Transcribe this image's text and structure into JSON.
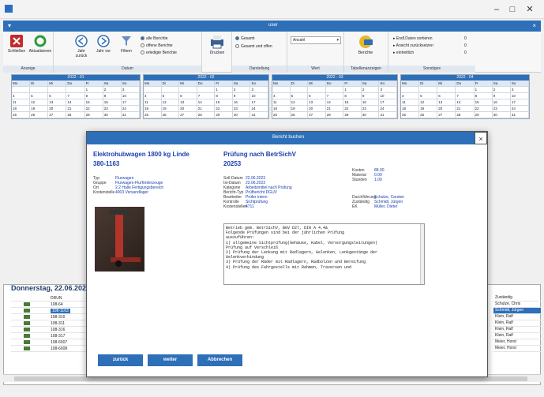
{
  "window": {
    "title": "",
    "controls": [
      "–",
      "□",
      "✕"
    ]
  },
  "ribbon_bar": {
    "title": "user",
    "menu": "▾",
    "close": "×"
  },
  "ribbon": {
    "anzeige": {
      "label": "Anzeige",
      "buttons": [
        "Schließen",
        "Aktualisieren"
      ]
    },
    "datum": {
      "label": "Datum",
      "buttons": [
        "Jahr zurück",
        "Jahr vor",
        "Filtern"
      ],
      "radios": [
        "alle Berichte",
        "offene Berichte",
        "erledigte Berichte"
      ],
      "selected": 0
    },
    "drucken": {
      "label": "Drucken"
    },
    "darstellung": {
      "label": "Darstellung",
      "radios": [
        "Gesamt",
        "Gesamt und offen"
      ],
      "selected": 0
    },
    "wert": {
      "label": "Wert",
      "value": "Anzahl"
    },
    "tabellen": {
      "label": "Tabellenanzeigen",
      "button": "Berichte"
    },
    "sonstiges": {
      "label": "Sonstiges",
      "items": [
        "Endl.Daten sortieren",
        "Ansicht zurücksetzen",
        "einheitlich"
      ],
      "values": [
        "0",
        "0",
        "0"
      ]
    }
  },
  "calendars": [
    {
      "title": "2022 - 01"
    },
    {
      "title": "2022 - 02"
    },
    {
      "title": "2022 - 03"
    },
    {
      "title": "2022 - 04"
    }
  ],
  "weekdays": [
    "Mo",
    "Di",
    "Mi",
    "Do",
    "Fr",
    "Sa",
    "So"
  ],
  "cal_rows": [
    [
      "",
      "",
      "",
      "",
      "1",
      "2",
      "3"
    ],
    [
      "4",
      "5",
      "6",
      "7",
      "8",
      "9",
      "10"
    ],
    [
      "11",
      "12",
      "13",
      "14",
      "15",
      "16",
      "17"
    ],
    [
      "18",
      "19",
      "20",
      "21",
      "22",
      "23",
      "24"
    ],
    [
      "25",
      "26",
      "27",
      "28",
      "29",
      "30",
      "31"
    ]
  ],
  "bottom": {
    "date": "Donnerstag, 22.06.2023",
    "rows": [
      {
        "code": "108-64"
      },
      {
        "code": "108-1163",
        "selected": true
      },
      {
        "code": "108-310"
      },
      {
        "code": "108-311"
      },
      {
        "code": "108-316"
      },
      {
        "code": "108-317"
      },
      {
        "code": "108-6007"
      },
      {
        "code": "108-6008"
      }
    ],
    "header": "DRUN",
    "right_header": "Zuständig",
    "right_rows": [
      "Schulze, Chris",
      "Schmidt, Jürgen",
      "Klein, Ralf",
      "Klein, Ralf",
      "Klein, Ralf",
      "Klein, Ralf",
      "Meier, Horst",
      "Meier, Horst"
    ]
  },
  "modal": {
    "title": "Bericht buchen",
    "close": "×",
    "item_title": "Elektrohubwagen 1800 kg Linde",
    "item_id": "380-1163",
    "test_title": "Prüfung nach BetrSichV",
    "test_id": "20253",
    "left_kv": [
      [
        "Typ",
        "Flurwagen"
      ],
      [
        "Gruppe",
        "Flurwagen-Flurförderzeuge"
      ],
      [
        "Ort",
        "2.2 Halle Fertigungsbereich"
      ],
      [
        "Kostenstelle",
        "4003 Versandlager"
      ]
    ],
    "mid_kv": [
      [
        "Soll-Datum",
        "22.06.2023"
      ],
      [
        "Ist-Datum",
        "22.06.2023"
      ],
      [
        "Kategorie",
        "Arbeitsmittel nach Prüfung"
      ],
      [
        "Bericht-Typ",
        "Prüfbericht DGUV"
      ],
      [
        "Bearbeiter",
        "Prüfer intern"
      ],
      [
        "Kontrolle",
        "Sichtprüfung"
      ],
      [
        "Kostenstellen",
        "4711"
      ]
    ],
    "right_kv": [
      [
        "Kosten",
        "88.00"
      ],
      [
        "Material",
        "0.00"
      ],
      [
        "Stunden",
        "1.00"
      ]
    ],
    "right_kv2": [
      [
        "Durchführung",
        "Schulze, Carsten"
      ],
      [
        "Zuständig",
        "Schmidt, Jürgen"
      ],
      [
        "EK",
        "Müller, Dieter"
      ]
    ],
    "notes": "Betrieb gem. BetrSichV, BGV D27, DIN A 4.4&\nFolgende Prüfungen sind bei der jährlichen Prüfung\nauszuführen:\n1) allgemeine Sichtprüfung(Gehäuse, Kabel, Versorgungsleitungen)\nPrüfung auf Verschleiß\n2) Prüfung der Lenkung mit Radlagern, Gelenken, Lenkgestänge der\nGelenkverbindung\n3) Prüfung der Räder mit Radlagern, Radbolzen und Bereifung\n4) Prüfung des Fahrgestells mit Rahmen, Traversen und",
    "buttons": [
      "zurück",
      "weiter",
      "Abbrechen"
    ]
  },
  "colors": {
    "accent": "#2d6fb8",
    "link": "#1a3fae"
  }
}
